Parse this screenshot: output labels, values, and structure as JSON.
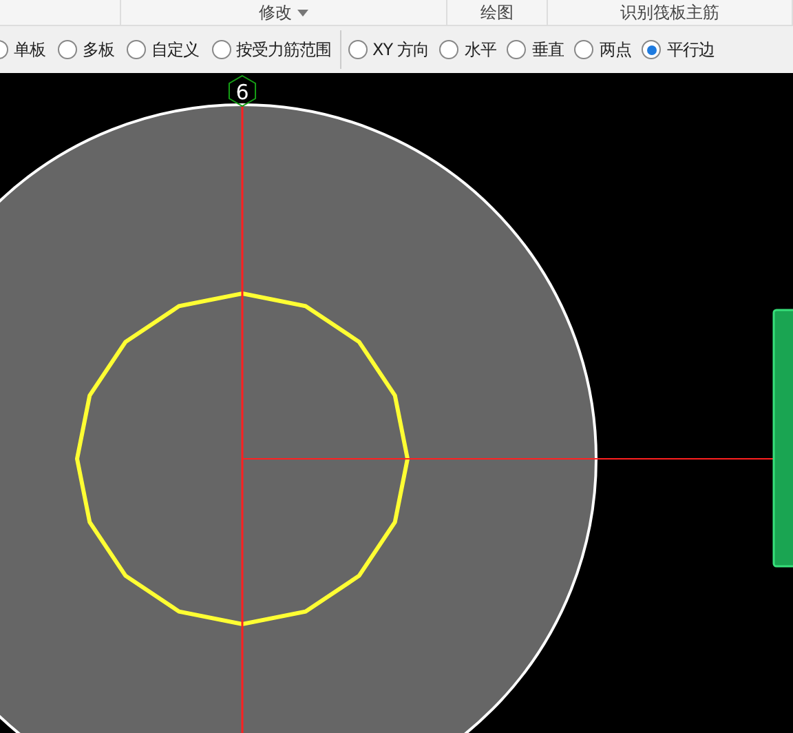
{
  "ribbon_groups": [
    {
      "label": "修改",
      "dropdown": true
    },
    {
      "label": "绘图",
      "dropdown": false
    },
    {
      "label": "识别筏板主筋",
      "dropdown": false
    }
  ],
  "scope_options": [
    {
      "label": "单板",
      "selected": false
    },
    {
      "label": "多板",
      "selected": false
    },
    {
      "label": "自定义",
      "selected": false
    },
    {
      "label": "按受力筋范围",
      "selected": false
    }
  ],
  "direction_options": [
    {
      "label": "XY 方向",
      "selected": false
    },
    {
      "label": "水平",
      "selected": false
    },
    {
      "label": "垂直",
      "selected": false
    },
    {
      "label": "两点",
      "selected": false
    },
    {
      "label": "平行边",
      "selected": true
    }
  ],
  "canvas": {
    "axis_label": "6"
  }
}
